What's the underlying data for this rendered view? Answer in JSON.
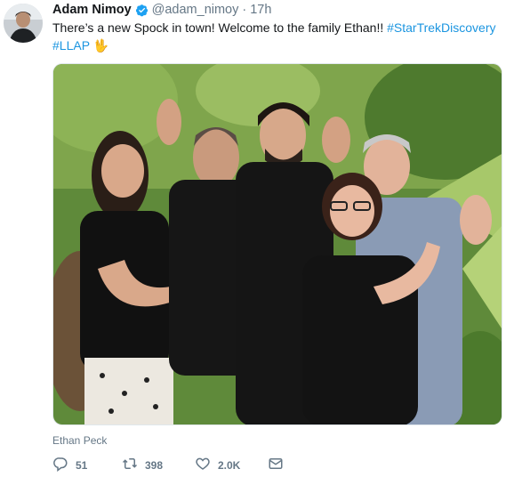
{
  "tweet": {
    "author_name": "Adam Nimoy",
    "author_handle": "@adam_nimoy",
    "separator": "·",
    "timestamp": "17h",
    "text_plain": "There’s a new Spock in town! Welcome to the family Ethan!! ",
    "hashtags": [
      "#StarTrekDiscovery",
      "#LLAP"
    ],
    "emoji": "🖖",
    "tagged_person": "Ethan Peck",
    "verified_icon": "verified-badge-icon",
    "colors": {
      "link": "#1b95e0",
      "muted": "#657786",
      "verified": "#1da1f2"
    }
  },
  "actions": {
    "reply_count": "51",
    "retweet_count": "398",
    "like_count": "2.0K"
  },
  "icons": [
    "reply-icon",
    "retweet-icon",
    "like-icon",
    "direct-message-icon"
  ]
}
